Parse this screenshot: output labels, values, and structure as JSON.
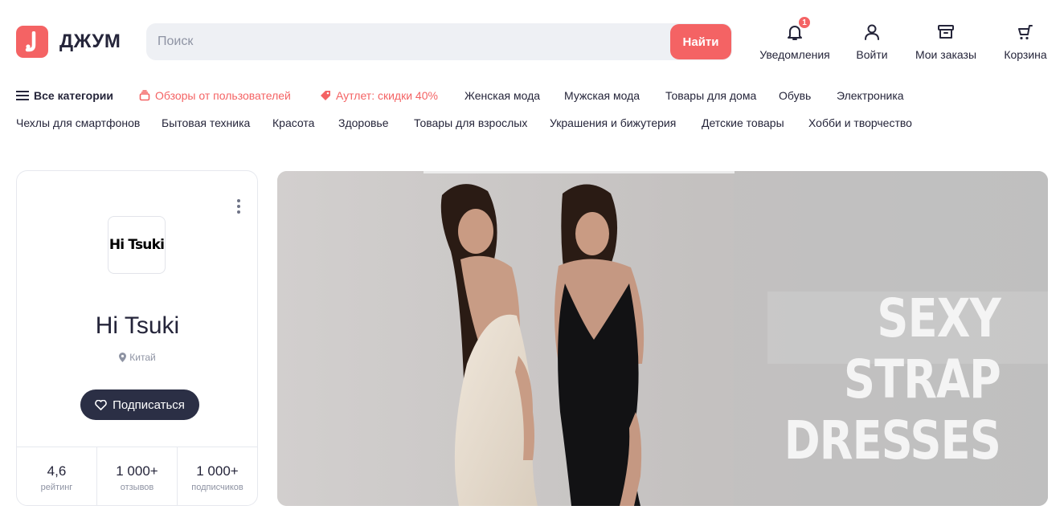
{
  "header": {
    "logo_text": "ДЖУМ",
    "search": {
      "placeholder": "Поиск",
      "value": "",
      "button_label": "Найти"
    },
    "actions": [
      {
        "label": "Уведомления",
        "icon": "bell-icon",
        "badge": "1"
      },
      {
        "label": "Войти",
        "icon": "user-icon"
      },
      {
        "label": "Мои заказы",
        "icon": "orders-box-icon"
      },
      {
        "label": "Корзина",
        "icon": "cart-icon"
      }
    ]
  },
  "categories": {
    "row1": [
      {
        "label": "Все категории",
        "icon": "menu-icon"
      },
      {
        "label": "Обзоры от пользователей",
        "icon": "reviews-icon"
      },
      {
        "label": "Аутлет: скидки 40%",
        "icon": "tag-icon"
      },
      {
        "label": "Женская мода"
      },
      {
        "label": "Мужская мода"
      },
      {
        "label": "Товары для дома"
      },
      {
        "label": "Обувь"
      },
      {
        "label": "Электроника"
      }
    ],
    "row2": [
      {
        "label": "Чехлы для смартфонов"
      },
      {
        "label": "Бытовая техника"
      },
      {
        "label": "Красота"
      },
      {
        "label": "Здоровье"
      },
      {
        "label": "Товары для взрослых"
      },
      {
        "label": "Украшения и бижутерия"
      },
      {
        "label": "Детские товары"
      },
      {
        "label": "Хобби и творчество"
      }
    ]
  },
  "store": {
    "logo_text": "Hi Tsuki",
    "name": "Hi Tsuki",
    "location": "Китай",
    "subscribe_label": "Подписаться",
    "stats": [
      {
        "value": "4,6",
        "label": "рейтинг"
      },
      {
        "value": "1 000+",
        "label": "отзывов"
      },
      {
        "value": "1 000+",
        "label": "подписчиков"
      }
    ]
  },
  "banner": {
    "headline_line1": "SEXY STRAP",
    "headline_line2": "DRESSES"
  },
  "colors": {
    "accent": "#f46364",
    "dark_button": "#2b2f45",
    "text": "#25253a",
    "muted": "#8e93a3"
  }
}
